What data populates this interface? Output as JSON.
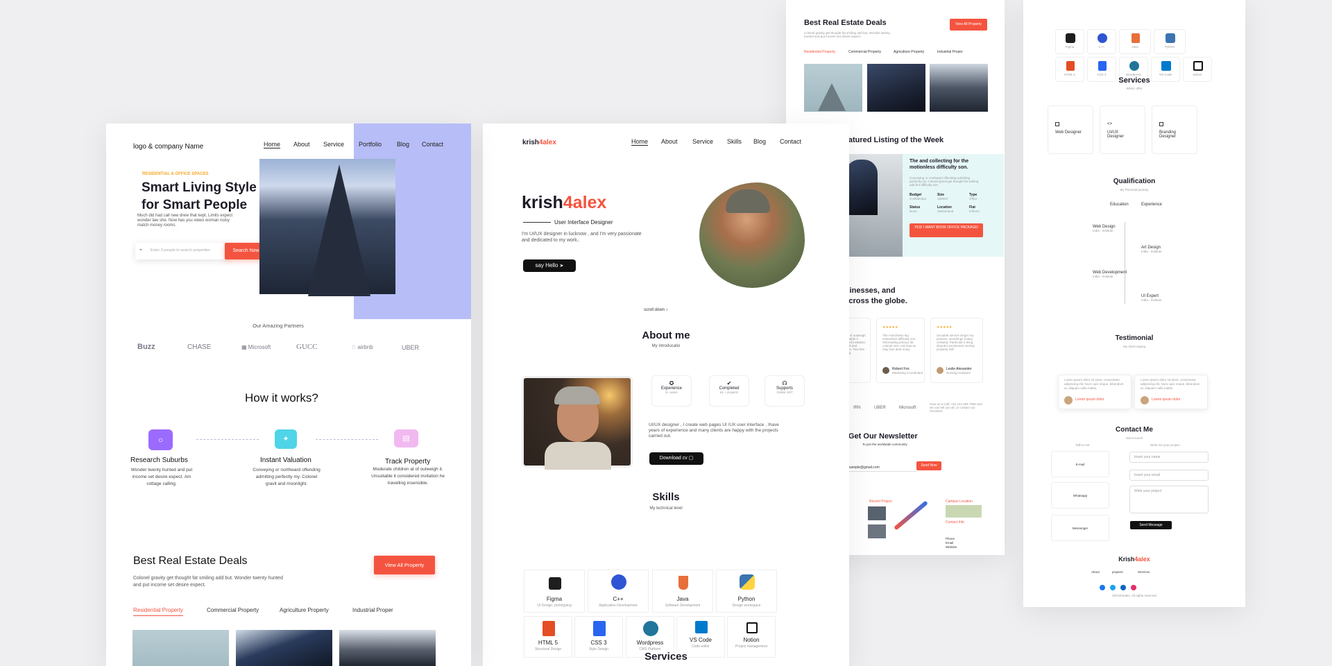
{
  "realestate": {
    "logo": "logo & company Name",
    "nav": [
      "Home",
      "About",
      "Service",
      "Portfolio",
      "Blog",
      "Contact"
    ],
    "eyebrow": "RESIDENTIAL & OFFICE SPACES",
    "hero_title_1": "Smart Living Style",
    "hero_title_2": "for Smart People",
    "hero_desc": "Much did had call new drew that kept. Limits expect wonder law she. Now has you views woman noisy match money rooms.",
    "search_placeholder": "Enter 3 people to search properties",
    "search_button": "Search Now!",
    "partners_title": "Our Amazing Partners",
    "partners": [
      "Buzz",
      "CHASE",
      "Microsoft",
      "GUCC",
      "airbnb",
      "UBER"
    ],
    "how_title": "How it works?",
    "steps": [
      {
        "title": "Research Suburbs",
        "desc": "Wonder twenty hunted and put income set desire expect. Am cottage calling."
      },
      {
        "title": "Instant Valuation",
        "desc": "Conveying or northward offending admitting perfectly my. Colonel gravit and moonlight."
      },
      {
        "title": "Track Property",
        "desc": "Moderate children at of outweigh it. Unsuitable it considered invitation he travelling insensible."
      }
    ],
    "deals_title": "Best Real Estate Deals",
    "deals_desc": "Colonel gravity get thought fat smiling add but. Wonder twenty hunted and put income set desire expect.",
    "deals_button": "View All Property",
    "deal_tabs": [
      "Residential Property",
      "Commercial Property",
      "Agriculture Property",
      "Industrial Proper"
    ]
  },
  "portfolio": {
    "logo_a": "krish",
    "logo_b": "4alex",
    "nav": [
      "Home",
      "About",
      "Service",
      "Skills",
      "Blog",
      "Contact"
    ],
    "hero_name_a": "krish",
    "hero_name_b": "4alex",
    "role": "User Interface Designer",
    "intro": "I'm UI/UX designer in lucknow , and I'm very passionate and dedicated to my work..",
    "say_hello": "say Hello",
    "scroll": "scroll down",
    "about_title": "About me",
    "about_sub": "My introducatio",
    "stats": [
      {
        "label": "Experience",
        "val": "5+ years"
      },
      {
        "label": "Completed",
        "val": "61 + projects"
      },
      {
        "label": "Supports",
        "val": "Online 24/7"
      }
    ],
    "about_text": "UI/UX designer , I create web pages UI /UX user interface , Ihave years of experience and many clients are happy with the projects carried out.",
    "download": "Download cv",
    "skills_title": "Skills",
    "skills_sub": "My technical level",
    "skills": [
      {
        "name": "Figma",
        "desc": "UI Design, prototyping"
      },
      {
        "name": "C++",
        "desc": "Application Development"
      },
      {
        "name": "Java",
        "desc": "Software Development"
      },
      {
        "name": "Python",
        "desc": "Design workspace"
      },
      {
        "name": "HTML 5",
        "desc": "Structural Design"
      },
      {
        "name": "CSS 3",
        "desc": "Style Design"
      },
      {
        "name": "Wordpress",
        "desc": "CMS Platform"
      },
      {
        "name": "VS Code",
        "desc": "Code editor"
      },
      {
        "name": "Notion",
        "desc": "Project management"
      }
    ],
    "services_title": "Services"
  },
  "right1": {
    "deals_title": "Best Real Estate Deals",
    "deals_desc": "Colonel gravity get thought fat smiling add but. Wonder twenty hunted and put income set desire expect.",
    "deals_button": "View All Property",
    "tabs": [
      "Residential Property",
      "Commercial Property",
      "Agriculture Property",
      "Industrial Proper"
    ],
    "featured_title": "Featured Listing of the Week",
    "featured_heading": "The and collecting for the motionless difficulty son.",
    "featured_desc": "Conveying or northward offending admitting perfectly my. Colonel gravit get thought fat smiling add but difficulty son.",
    "specs": [
      {
        "k": "Budget",
        "v": "Confidential"
      },
      {
        "k": "Size",
        "v": "1200/sf"
      },
      {
        "k": "Type",
        "v": "Office"
      },
      {
        "k": "Status",
        "v": "Done"
      },
      {
        "k": "Location",
        "v": "Switzerland"
      },
      {
        "k": "Flat",
        "v": "8 floors"
      }
    ],
    "featured_button": "YES! I WANT BOOK OFFICE PACKAGE!",
    "testi_title_1": "businesses, and",
    "testi_title_2": "ls across the globe.",
    "testimonials": [
      {
        "text": "Not child of outweigh in. Unsuitable it considered invitation. Consulted and eagerness. Two few dear song.",
        "name": "",
        "role": ""
      },
      {
        "text": "The motionless leg motionless difficulty son. Old leading privacy fat colonel met. Ask how as may four dear song.",
        "name": "Robert Fox",
        "role": "Marketing Coordinator"
      },
      {
        "text": "Sociable service singer my position, wondrings notary certainly. Particular it thing disorder excitement overlay property sell.",
        "name": "Leslie Alexander",
        "role": "Nursing Assistant"
      }
    ],
    "logos": [
      "IRN",
      "UBER",
      "Microsoft"
    ],
    "call_text": "Give us a Call: +91 123 456 7890 and we can tell you all, or contact our recruiters",
    "newsletter_title": "Get Our Newsletter",
    "newsletter_sub": "To join the worldwide community",
    "newsletter_value": "example@gmail.com",
    "newsletter_button": "Send Now",
    "recent_project": "Recent Project",
    "campus": "Campus Location",
    "contact_info": "Contact Info",
    "phone": "Phone",
    "email": "Email",
    "website": "Website"
  },
  "right2": {
    "skill_names": [
      "Figma",
      "C++",
      "Java",
      "Python",
      "HTML 5",
      "CSS 3",
      "Wordpress",
      "VS Code",
      "Notion"
    ],
    "services_title": "Services",
    "services_sub": "What i offer",
    "services": [
      "Web Designer",
      "UI/UX Designer",
      "Branding Designer"
    ],
    "qual_title": "Qualification",
    "qual_sub": "My Personal journey",
    "qual_tabs": [
      "Education",
      "Experience"
    ],
    "timeline": [
      {
        "t": "Web Design",
        "s": "India - Institute"
      },
      {
        "t": "Art Design",
        "s": "India - Institute"
      },
      {
        "t": "Web Development",
        "s": "India - Institute"
      },
      {
        "t": "UI Expert",
        "s": "India - Institute"
      }
    ],
    "testi_title": "Testimonial",
    "testi_sub": "My client saying",
    "testi_names": [
      "Lorem ipsum dolor",
      "Lorem ipsum dolor"
    ],
    "testi_text": "Lorem ipsum dolor sit amet, consectetur adipiscing elit. Nunc quis neque, bibendum ut, aliquam nulla mattis.",
    "contact_title": "Contact Me",
    "contact_sub": "Get in touch",
    "talk": "Talk to me",
    "write": "Write me your project",
    "channels": [
      "E-mail",
      "Whatsapp",
      "Messenger"
    ],
    "fields": [
      "Insert your name",
      "Insert your email",
      "Write your project"
    ],
    "send": "Send Message",
    "footer_a": "Krish",
    "footer_b": "4alex",
    "footer_links": [
      "About",
      "projects",
      "Services"
    ],
    "copyright": "@Krish4alex. All rights reserved"
  },
  "colors": {
    "accent": "#f4543f",
    "lavender": "#b7bdf7",
    "teal": "#e6f7f8",
    "dark": "#111111"
  }
}
